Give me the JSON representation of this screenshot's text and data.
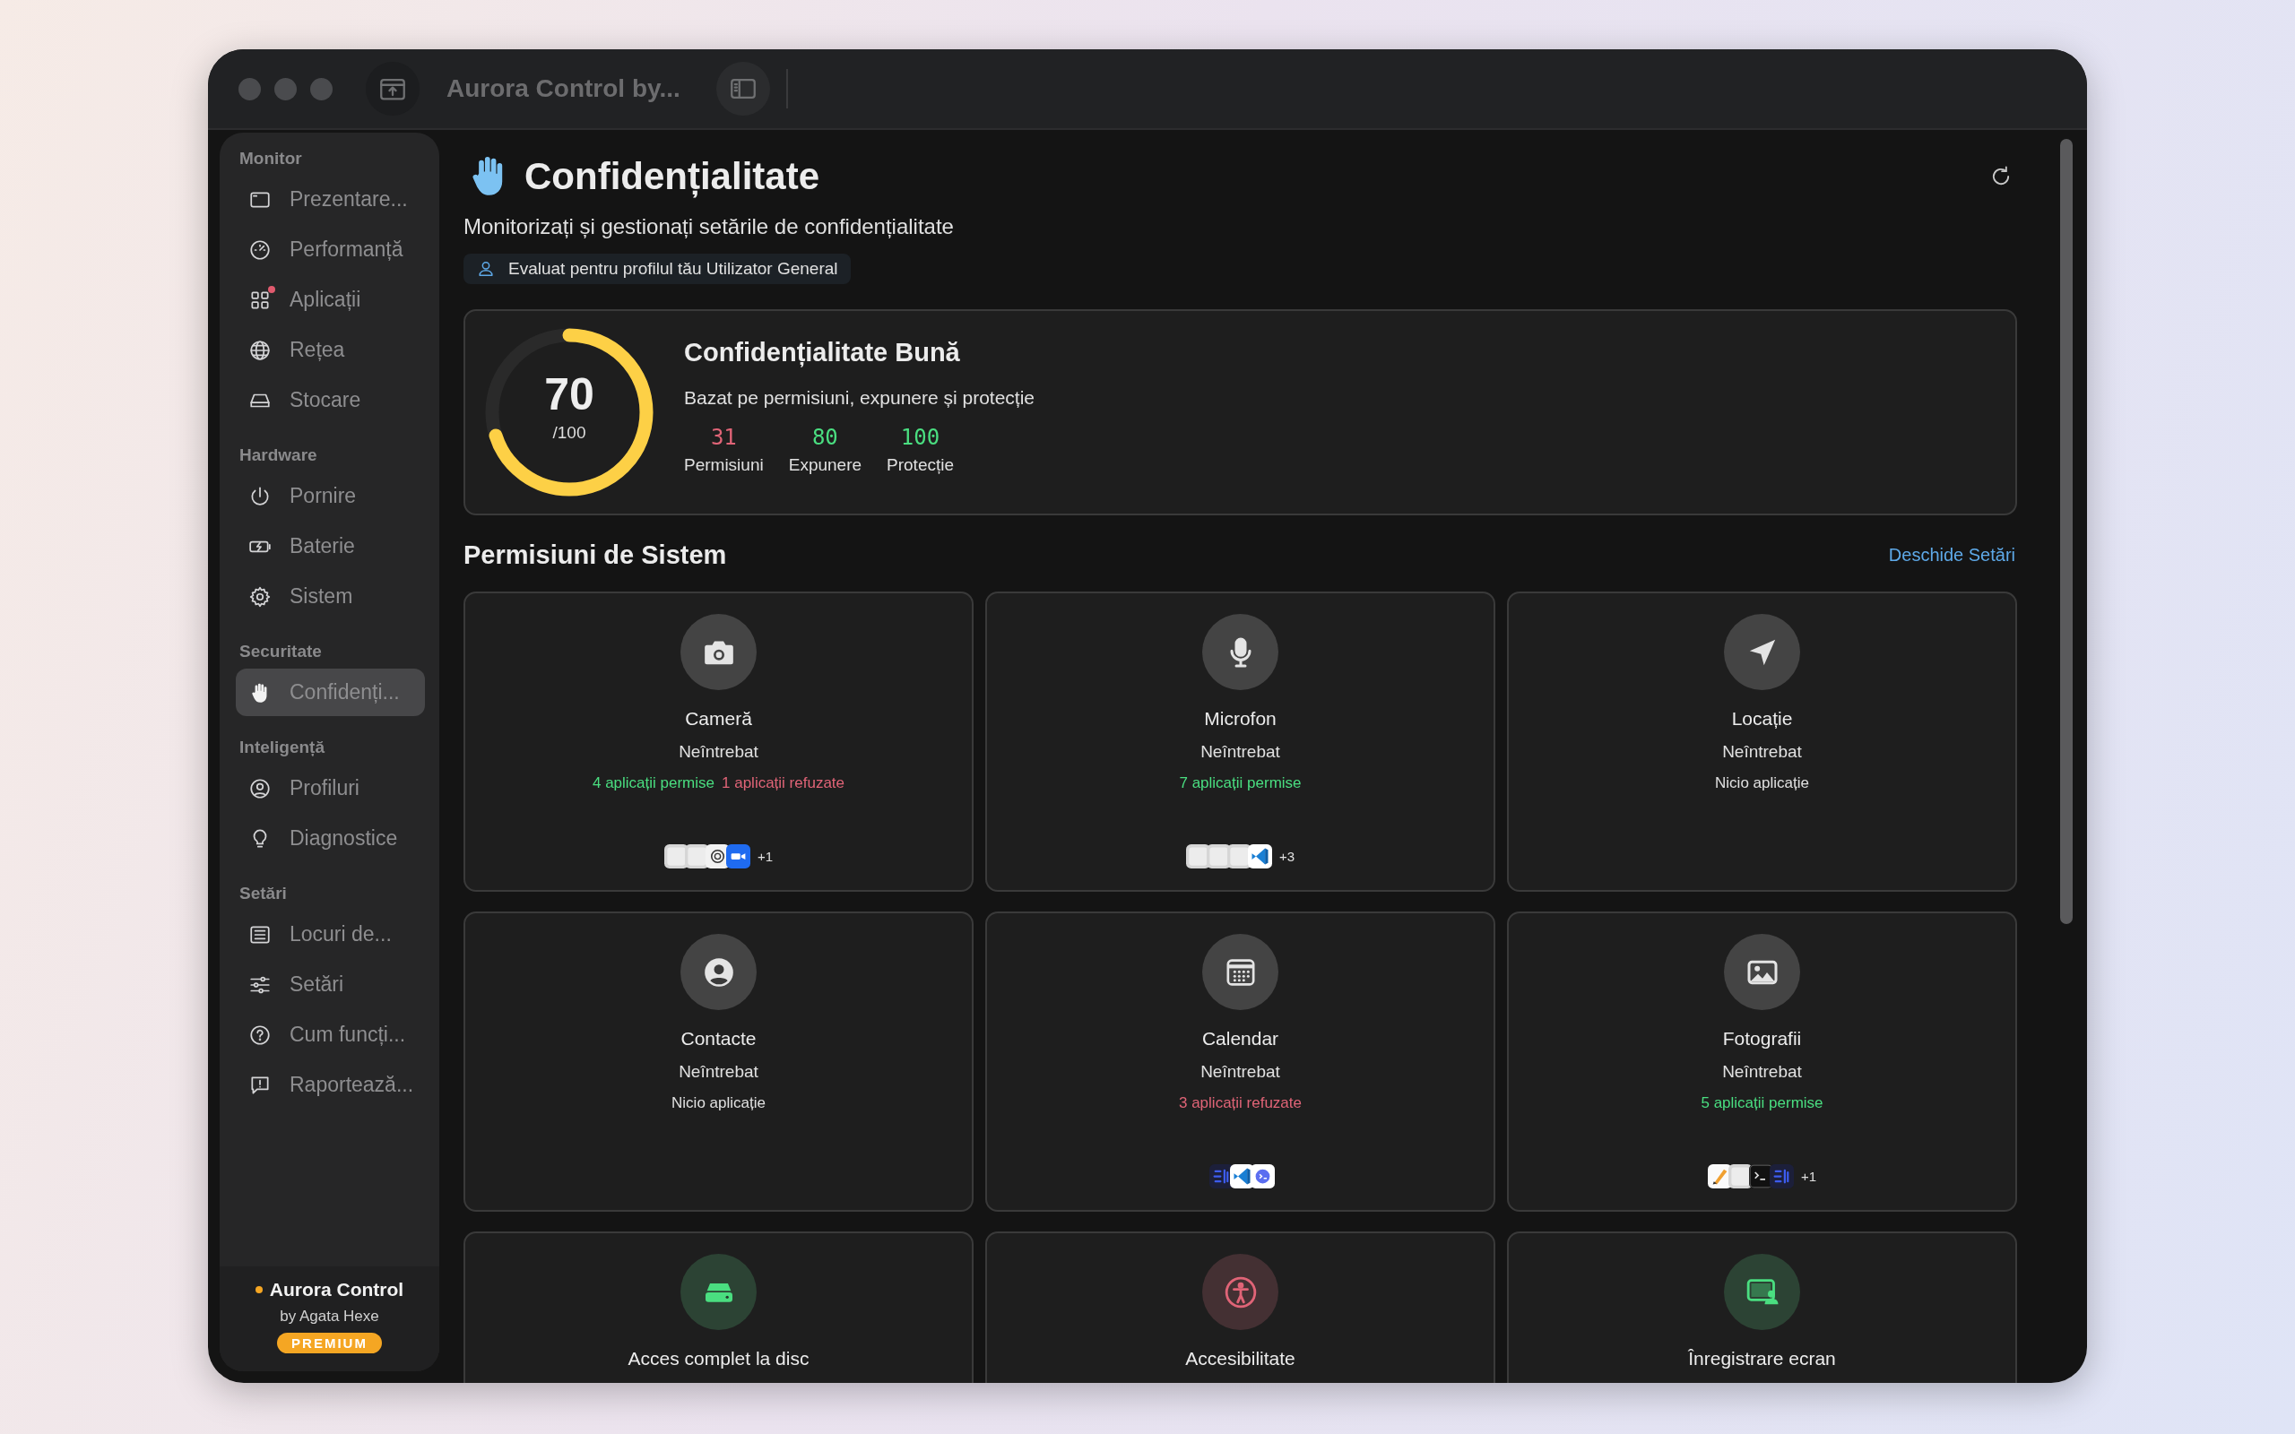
{
  "window": {
    "title": "Aurora Control by..."
  },
  "sidebar": {
    "sections": [
      {
        "title": "Monitor",
        "items": [
          {
            "label": "Prezentare...",
            "selected": false,
            "notification": false
          },
          {
            "label": "Performanță",
            "selected": false,
            "notification": false
          },
          {
            "label": "Aplicații",
            "selected": false,
            "notification": true
          },
          {
            "label": "Rețea",
            "selected": false,
            "notification": false
          },
          {
            "label": "Stocare",
            "selected": false,
            "notification": false
          }
        ]
      },
      {
        "title": "Hardware",
        "items": [
          {
            "label": "Pornire",
            "selected": false,
            "notification": false
          },
          {
            "label": "Baterie",
            "selected": false,
            "notification": false
          },
          {
            "label": "Sistem",
            "selected": false,
            "notification": false
          }
        ]
      },
      {
        "title": "Securitate",
        "items": [
          {
            "label": "Confidenți...",
            "selected": true,
            "notification": false
          }
        ]
      },
      {
        "title": "Inteligență",
        "items": [
          {
            "label": "Profiluri",
            "selected": false,
            "notification": false
          },
          {
            "label": "Diagnostice",
            "selected": false,
            "notification": false
          }
        ]
      },
      {
        "title": "Setări",
        "items": [
          {
            "label": "Locuri de...",
            "selected": false,
            "notification": false
          },
          {
            "label": "Setări",
            "selected": false,
            "notification": false
          },
          {
            "label": "Cum funcți...",
            "selected": false,
            "notification": false
          },
          {
            "label": "Raportează...",
            "selected": false,
            "notification": false
          }
        ]
      }
    ],
    "footer": {
      "app_name": "Aurora Control",
      "author": "by Agata Hexe",
      "badge": "PREMIUM"
    }
  },
  "header": {
    "title": "Confidențialitate",
    "subtitle": "Monitorizați și gestionați setările de confidențialitate",
    "profile_badge": "Evaluat pentru profilul tău Utilizator General"
  },
  "score": {
    "value": "70",
    "max": "/100",
    "level": 0.7,
    "title": "Confidențialitate Bună",
    "description": "Bazat pe permisiuni, expunere și protecție",
    "stats": [
      {
        "value": "31",
        "label": "Permisiuni",
        "color": "#e06477"
      },
      {
        "value": "80",
        "label": "Expunere",
        "color": "#4ade80"
      },
      {
        "value": "100",
        "label": "Protecție",
        "color": "#4ade80"
      }
    ]
  },
  "permissions": {
    "title": "Permisiuni de Sistem",
    "link": "Deschide Setări",
    "cards": [
      {
        "name": "Cameră",
        "color": "#e4e4e4",
        "status": "Neîntrebat",
        "summary": [
          {
            "text": "4 aplicații permise",
            "color": "#4ade80"
          },
          {
            "text": "1 aplicații refuzate",
            "color": "#e06477"
          }
        ],
        "apps": [
          {
            "kind": "tile"
          },
          {
            "kind": "tile"
          },
          {
            "kind": "swirl"
          },
          {
            "kind": "video"
          }
        ],
        "more": "+1"
      },
      {
        "name": "Microfon",
        "color": "#e4e4e4",
        "status": "Neîntrebat",
        "summary": [
          {
            "text": "7 aplicații permise",
            "color": "#4ade80"
          }
        ],
        "apps": [
          {
            "kind": "tile"
          },
          {
            "kind": "tile"
          },
          {
            "kind": "tile"
          },
          {
            "kind": "code"
          }
        ],
        "more": "+3"
      },
      {
        "name": "Locație",
        "color": "#e4e4e4",
        "status": "Neîntrebat",
        "summary": [
          {
            "text": "Nicio aplicație",
            "color": "#e0e0e0"
          }
        ]
      },
      {
        "name": "Contacte",
        "color": "#e4e4e4",
        "status": "Neîntrebat",
        "summary": [
          {
            "text": "Nicio aplicație",
            "color": "#e0e0e0"
          }
        ]
      },
      {
        "name": "Calendar",
        "color": "#e4e4e4",
        "status": "Neîntrebat",
        "summary": [
          {
            "text": "3 aplicații refuzate",
            "color": "#e06477"
          }
        ],
        "apps": [
          {
            "kind": "script"
          },
          {
            "kind": "code"
          },
          {
            "kind": "bubble"
          }
        ]
      },
      {
        "name": "Fotografii",
        "color": "#e4e4e4",
        "status": "Neîntrebat",
        "summary": [
          {
            "text": "5 aplicații permise",
            "color": "#4ade80"
          }
        ],
        "apps": [
          {
            "kind": "pen"
          },
          {
            "kind": "tile"
          },
          {
            "kind": "terminal"
          },
          {
            "kind": "script"
          }
        ],
        "more": "+1"
      },
      {
        "name": "Acces complet la disc",
        "color": "#4ade80"
      },
      {
        "name": "Accesibilitate",
        "color": "#e06477"
      },
      {
        "name": "Înregistrare ecran",
        "color": "#4ade80"
      }
    ]
  }
}
